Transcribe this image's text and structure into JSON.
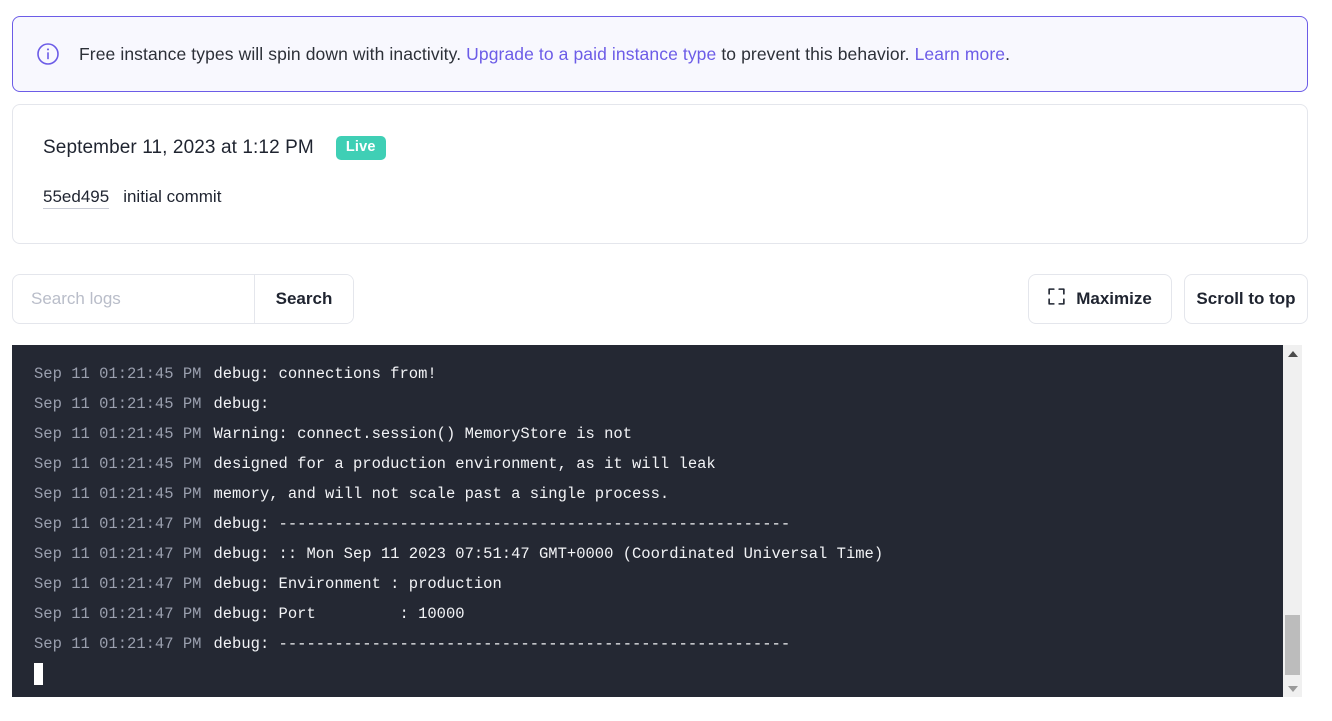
{
  "banner": {
    "icon": "info-circle-icon",
    "text_before": "Free instance types will spin down with inactivity.",
    "link_upgrade": "Upgrade to a paid instance type",
    "text_middle": "to prevent this behavior.",
    "link_learn": "Learn more",
    "text_after": ".",
    "accent_color": "#6c5ce7",
    "background_color": "#f8f8fe"
  },
  "deploy": {
    "timestamp": "September 11, 2023 at 1:12 PM",
    "status_badge": "Live",
    "status_color": "#3fcfb5",
    "commit_hash": "55ed495",
    "commit_message": "initial commit"
  },
  "toolbar": {
    "search_placeholder": "Search logs",
    "search_value": "",
    "search_button": "Search",
    "maximize_label": "Maximize",
    "maximize_icon": "expand-corners-icon",
    "scroll_top_label": "Scroll to top"
  },
  "console": {
    "background_color": "#242833",
    "timestamp_color": "#9a9fae",
    "message_color": "#f2f3f6",
    "cursor": "block-cursor",
    "lines": [
      {
        "timestamp": "Sep 11 01:21:45 PM",
        "message": "debug: connections from!"
      },
      {
        "timestamp": "Sep 11 01:21:45 PM",
        "message": "debug:"
      },
      {
        "timestamp": "Sep 11 01:21:45 PM",
        "message": "Warning: connect.session() MemoryStore is not"
      },
      {
        "timestamp": "Sep 11 01:21:45 PM",
        "message": "designed for a production environment, as it will leak"
      },
      {
        "timestamp": "Sep 11 01:21:45 PM",
        "message": "memory, and will not scale past a single process."
      },
      {
        "timestamp": "Sep 11 01:21:47 PM",
        "message": "debug: -------------------------------------------------------"
      },
      {
        "timestamp": "Sep 11 01:21:47 PM",
        "message": "debug: :: Mon Sep 11 2023 07:51:47 GMT+0000 (Coordinated Universal Time)"
      },
      {
        "timestamp": "Sep 11 01:21:47 PM",
        "message": "debug: Environment : production"
      },
      {
        "timestamp": "Sep 11 01:21:47 PM",
        "message": "debug: Port         : 10000"
      },
      {
        "timestamp": "Sep 11 01:21:47 PM",
        "message": "debug: -------------------------------------------------------"
      }
    ]
  },
  "scrollbar": {
    "up_arrow": "scroll-up-arrow",
    "down_arrow": "scroll-down-arrow"
  }
}
